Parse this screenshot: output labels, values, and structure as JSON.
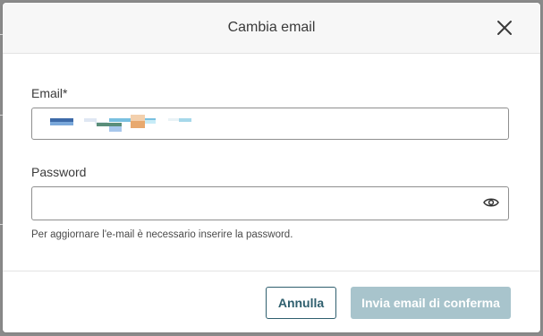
{
  "dialog": {
    "title": "Cambia email",
    "email_label": "Email*",
    "email_value": "",
    "password_label": "Password",
    "password_value": "",
    "hint": "Per aggiornare l'e-mail è necessario inserire la password.",
    "cancel_label": "Annulla",
    "confirm_label": "Invia email di conferma"
  },
  "icons": {
    "close": "close-icon",
    "password_toggle": "eye-icon"
  },
  "colors": {
    "primary": "#2f5f6e",
    "primary_disabled": "#a8c4cc",
    "header_bg": "#f7f7f7"
  }
}
